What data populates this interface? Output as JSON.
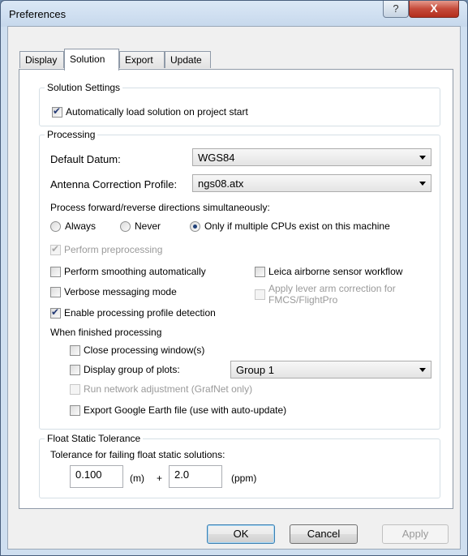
{
  "window": {
    "title": "Preferences",
    "help": "?",
    "close": "X"
  },
  "tabs": [
    "Display",
    "Solution",
    "Export",
    "Update"
  ],
  "solution_settings": {
    "label": "Solution Settings",
    "auto_load": {
      "label": "Automatically load solution on project start",
      "checked": true
    }
  },
  "processing": {
    "label": "Processing",
    "default_datum_label": "Default Datum:",
    "default_datum_value": "WGS84",
    "antenna_label": "Antenna Correction Profile:",
    "antenna_value": "ngs08.atx",
    "process_dirs_label": "Process forward/reverse directions simultaneously:",
    "radios": [
      "Always",
      "Never",
      "Only if multiple CPUs exist on this machine"
    ],
    "radio_selected": 2,
    "perform_preprocessing": "Perform preprocessing",
    "perform_smoothing": "Perform smoothing automatically",
    "leica_airborne": "Leica airborne sensor workflow",
    "verbose": "Verbose messaging mode",
    "lever_arm": "Apply lever arm correction for",
    "lever_arm_2": "FMCS/FlightPro",
    "enable_profile": "Enable processing profile detection",
    "when_finished": "When finished processing",
    "close_windows": "Close processing window(s)",
    "display_plots": "Display group of plots:",
    "plot_group_value": "Group 1",
    "run_network": "Run network adjustment (GrafNet only)",
    "export_ge": "Export Google Earth file (use with auto-update)"
  },
  "float_static": {
    "label": "Float Static Tolerance",
    "tolerance_label": "Tolerance for failing float static solutions:",
    "m_value": "0.100",
    "m_unit": "(m)",
    "plus": "+",
    "ppm_value": "2.0",
    "ppm_unit": "(ppm)"
  },
  "buttons": {
    "ok": "OK",
    "cancel": "Cancel",
    "apply": "Apply"
  }
}
